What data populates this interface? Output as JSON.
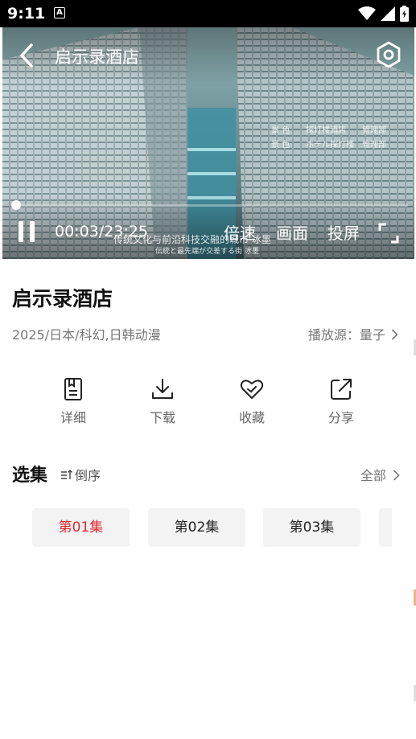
{
  "status_bar": {
    "time": "9:11",
    "notification_badge": "A"
  },
  "player": {
    "title": "启示录酒店",
    "current_time": "00:03",
    "duration": "23:25",
    "time_display": "00:03/23:25",
    "progress": 0.002,
    "controls": {
      "speed": "倍速",
      "picture": "画面",
      "cast": "投屏"
    },
    "frame_text": {
      "line1": "景 色　　探灯楼酒店　　管理部",
      "line2": "景 色　　ホテル探灯楼　管理部",
      "subtitle_cn": "传统文化与前沿科技交融的城市 冰墨",
      "subtitle_jp": "伝統と最先端が交差する街 冰墨"
    }
  },
  "show": {
    "title": "启示录酒店",
    "meta": "2025/日本/科幻,日韩动漫",
    "source_label": "播放源：",
    "source_value": "量子"
  },
  "actions": [
    {
      "label": "详细",
      "icon": "document-icon"
    },
    {
      "label": "下载",
      "icon": "download-icon"
    },
    {
      "label": "收藏",
      "icon": "heart-icon"
    },
    {
      "label": "分享",
      "icon": "share-icon"
    }
  ],
  "episodes_section": {
    "title": "选集",
    "sort_label": "倒序",
    "all_label": "全部",
    "episodes": [
      "第01集",
      "第02集",
      "第03集"
    ],
    "active_index": 0
  },
  "colors": {
    "accent": "#e3262d",
    "muted": "#777777",
    "chip_bg": "#f3f3f3"
  }
}
